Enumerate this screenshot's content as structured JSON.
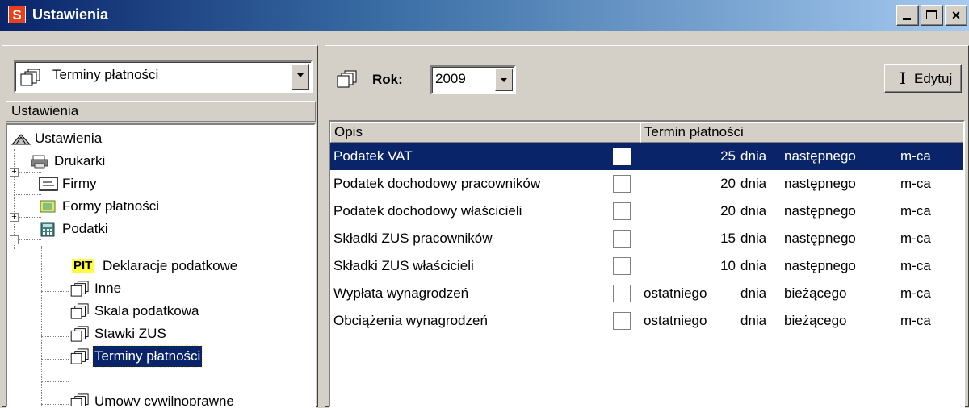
{
  "window": {
    "app_icon_letter": "S",
    "title": "Ustawienia",
    "minimize_label": "_",
    "close_label": "×"
  },
  "left": {
    "combo_value": "Terminy płatności",
    "header": "Ustawienia",
    "tree": [
      {
        "label": "Ustawienia",
        "icon": "settings-root-icon"
      },
      {
        "label": "Drukarki",
        "icon": "printer-icon"
      },
      {
        "label": "Firmy",
        "icon": "company-card-icon"
      },
      {
        "label": "Formy płatności",
        "icon": "payment-forms-icon"
      },
      {
        "label": "Podatki",
        "icon": "calculator-icon"
      },
      {
        "label": "Deklaracje podatkowe",
        "icon": "pit-icon",
        "badge": "PIT"
      },
      {
        "label": "Inne",
        "icon": "documents-icon"
      },
      {
        "label": "Skala podatkowa",
        "icon": "documents-icon"
      },
      {
        "label": "Stawki ZUS",
        "icon": "documents-icon"
      },
      {
        "label": "Terminy płatności",
        "icon": "documents-icon"
      },
      {
        "label": "Umowy cywilnoprawne",
        "icon": "documents-icon"
      }
    ],
    "expanders": {
      "plus": "+",
      "minus": "−"
    }
  },
  "right": {
    "rok_label_underlined": "R",
    "rok_label_rest": "ok:",
    "year": "2009",
    "edit_label": "Edytuj",
    "edit_glyph": "I",
    "columns": [
      "Opis",
      "Termin płatności"
    ],
    "rows": [
      {
        "desc": "Podatek VAT",
        "day": "25",
        "unit": "dnia",
        "month": "następnego",
        "suffix": "m-ca"
      },
      {
        "desc": "Podatek dochodowy pracowników",
        "day": "20",
        "unit": "dnia",
        "month": "następnego",
        "suffix": "m-ca"
      },
      {
        "desc": "Podatek dochodowy właścicieli",
        "day": "20",
        "unit": "dnia",
        "month": "następnego",
        "suffix": "m-ca"
      },
      {
        "desc": "Składki ZUS pracowników",
        "day": "15",
        "unit": "dnia",
        "month": "następnego",
        "suffix": "m-ca"
      },
      {
        "desc": "Składki ZUS właścicieli",
        "day": "10",
        "unit": "dnia",
        "month": "następnego",
        "suffix": "m-ca"
      },
      {
        "desc": "Wypłata wynagrodzeń",
        "day": "ostatniego",
        "unit": "dnia",
        "month": "bieżącego",
        "suffix": "m-ca"
      },
      {
        "desc": "Obciążenia wynagrodzeń",
        "day": "ostatniego",
        "unit": "dnia",
        "month": "bieżącego",
        "suffix": "m-ca"
      }
    ]
  },
  "colors": {
    "selection": "#0a246a",
    "face": "#d4d0c8",
    "pit_badge": "#ffff40"
  }
}
